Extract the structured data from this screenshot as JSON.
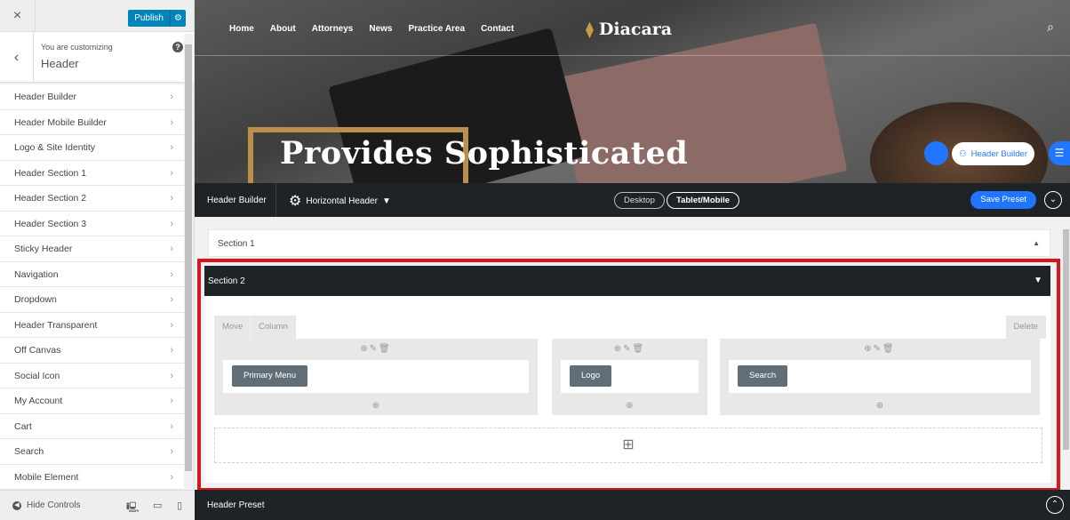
{
  "sidebar": {
    "close_icon": "×",
    "publish_label": "Publish",
    "gear_icon": "⚙",
    "back_icon": "‹",
    "customizing_label": "You are customizing",
    "panel_title": "Header",
    "help_icon": "?",
    "items": [
      {
        "label": "Header Builder"
      },
      {
        "label": "Header Mobile Builder"
      },
      {
        "label": "Logo & Site Identity"
      },
      {
        "label": "Header Section 1"
      },
      {
        "label": "Header Section 2"
      },
      {
        "label": "Header Section 3"
      },
      {
        "label": "Sticky Header"
      },
      {
        "label": "Navigation"
      },
      {
        "label": "Dropdown"
      },
      {
        "label": "Header Transparent"
      },
      {
        "label": "Off Canvas"
      },
      {
        "label": "Social Icon"
      },
      {
        "label": "My Account"
      },
      {
        "label": "Cart"
      },
      {
        "label": "Search"
      },
      {
        "label": "Mobile Element"
      }
    ],
    "chevron": "›",
    "hide_controls": "Hide Controls",
    "devices": [
      "desktop-icon",
      "tablet-icon",
      "mobile-icon"
    ]
  },
  "preview": {
    "nav": [
      "Home",
      "About",
      "Attorneys",
      "News",
      "Practice Area",
      "Contact"
    ],
    "logo_text": "Diacara",
    "hero_text": "Provides Sophisticated",
    "floating_label": "Header Builder",
    "accent": "#2176ff"
  },
  "builder_bar": {
    "label": "Header Builder",
    "header_type": "Horizontal Header",
    "desktop": "Desktop",
    "tablet_mobile": "Tablet/Mobile",
    "save_preset": "Save Preset"
  },
  "canvas": {
    "section1": "Section 1",
    "section2": "Section 2",
    "move": "Move",
    "column": "Column",
    "delete": "Delete",
    "columns": [
      {
        "element": "Primary Menu"
      },
      {
        "element": "Logo"
      },
      {
        "element": "Search"
      }
    ],
    "highlight_color": "#d9141c"
  },
  "preset_bar": {
    "label": "Header Preset"
  }
}
